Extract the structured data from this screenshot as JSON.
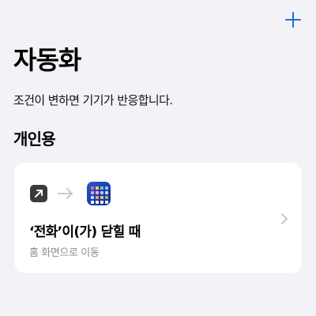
{
  "header": {
    "add_icon": "plus-icon",
    "accent_color": "#1a73e8"
  },
  "page": {
    "title": "자동화",
    "subtitle": "조건이 변하면 기기가 반응합니다."
  },
  "section": {
    "title": "개인용"
  },
  "automation_card": {
    "trigger_icon": "arrow-up-right-icon",
    "connector_icon": "arrow-right-icon",
    "app_icon": "home-screen-app-icon",
    "title": "‘전화’이(가) 닫힐 때",
    "subtitle": "홈 화면으로 이동",
    "chevron_icon": "chevron-right-icon"
  }
}
